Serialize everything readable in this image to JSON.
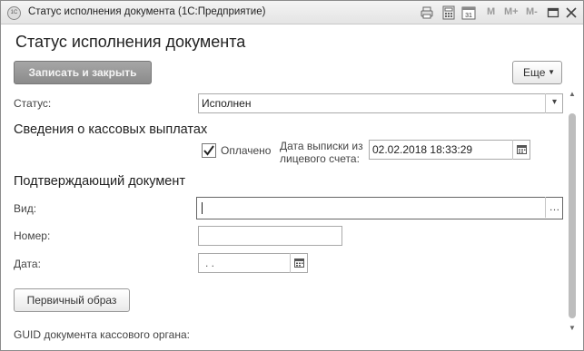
{
  "window": {
    "title": "Статус исполнения документа  (1С:Предприятие)",
    "app_icon_text": "1С",
    "toolbar": {
      "m": "M",
      "m_plus": "M+",
      "m_minus": "M-",
      "calendar_day": "31"
    }
  },
  "form": {
    "title": "Статус исполнения документа",
    "save_close_label": "Записать и закрыть",
    "more_label": "Еще"
  },
  "status": {
    "label": "Статус:",
    "value": "Исполнен"
  },
  "cash_section": {
    "title": "Сведения о кассовых выплатах",
    "paid_label": "Оплачено",
    "paid_checked": true,
    "statement_date_label_line1": "Дата выписки из",
    "statement_date_label_line2": "лицевого счета:",
    "statement_date_value": "02.02.2018 18:33:29"
  },
  "doc_section": {
    "title": "Подтверждающий документ",
    "kind_label": "Вид:",
    "kind_value": "",
    "number_label": "Номер:",
    "number_value": "",
    "date_label": "Дата:",
    "date_value": " .  ."
  },
  "primary_image_label": "Первичный образ",
  "guid_label": "GUID документа кассового органа:"
}
